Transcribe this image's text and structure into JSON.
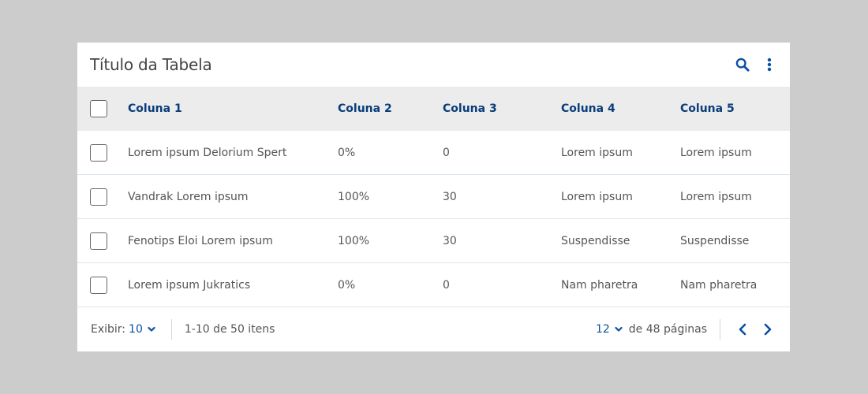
{
  "table": {
    "title": "Título da Tabela",
    "columns": [
      "Coluna 1",
      "Coluna 2",
      "Coluna 3",
      "Coluna 4",
      "Coluna 5"
    ],
    "rows": [
      [
        "Lorem ipsum Delorium Spert",
        "0%",
        "0",
        "Lorem ipsum",
        "Lorem ipsum"
      ],
      [
        "Vandrak Lorem ipsum",
        "100%",
        "30",
        "Lorem ipsum",
        "Lorem ipsum"
      ],
      [
        "Fenotips Eloi Lorem ipsum",
        "100%",
        "30",
        "Suspendisse",
        "Suspendisse"
      ],
      [
        "Lorem ipsum Jukratics",
        "0%",
        "0",
        "Nam pharetra",
        "Nam pharetra"
      ]
    ]
  },
  "icons": {
    "search": "search-icon",
    "more": "more-vertical-icon",
    "chevron_down": "chevron-down-icon",
    "prev": "chevron-left-icon",
    "next": "chevron-right-icon"
  },
  "footer": {
    "show_label": "Exibir:",
    "page_size": "10",
    "range_text": "1-10 de 50 itens",
    "current_page": "12",
    "pages_text": "de 48 páginas"
  },
  "colors": {
    "accent": "#0a4fa3",
    "header_text": "#0a3d7a",
    "header_bg": "#ececec",
    "page_bg": "#cccccc"
  }
}
